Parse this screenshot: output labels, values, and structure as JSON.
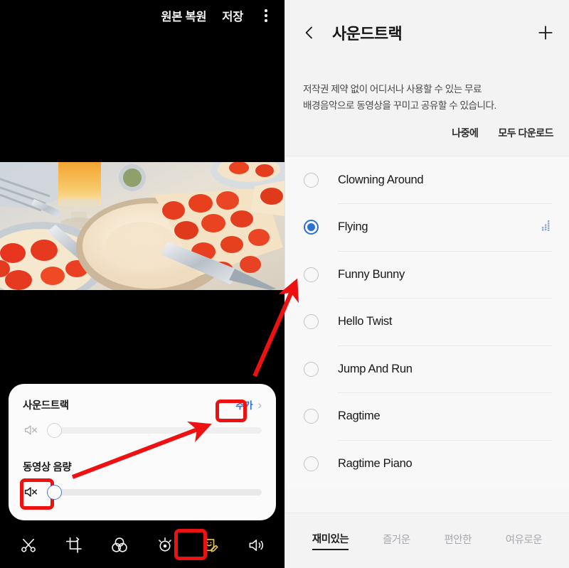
{
  "editor": {
    "topbar": {
      "restore_label": "원본 복원",
      "save_label": "저장",
      "menu_icon": "kebab-menu-icon"
    },
    "panel": {
      "soundtrack_label": "사운드트랙",
      "add_label": "추가",
      "chevron": "›",
      "video_volume_label": "동영상 음량",
      "soundtrack_volume_value": "0",
      "video_volume_value": "0",
      "mute_icon": "mute-icon"
    },
    "toolbar": {
      "items": [
        {
          "name": "trim-icon",
          "label": "자르기"
        },
        {
          "name": "crop-rotate-icon",
          "label": "회전"
        },
        {
          "name": "filter-icon",
          "label": "필터"
        },
        {
          "name": "brightness-icon",
          "label": "밝기"
        },
        {
          "name": "sticker-icon",
          "label": "스티커",
          "active": true
        },
        {
          "name": "volume-icon",
          "label": "음량"
        }
      ]
    }
  },
  "soundtrack": {
    "header": {
      "back_icon": "back-chevron-icon",
      "title": "사운드트랙",
      "add_icon": "plus-icon"
    },
    "description_line1": "저작권 제약 없이 어디서나 사용할 수 있는 무료",
    "description_line2": "배경음악으로 동영상을 꾸미고 공유할 수 있습니다.",
    "actions": {
      "later_label": "나중에",
      "download_all_label": "모두 다운로드"
    },
    "tracks": [
      {
        "name": "Clowning Around",
        "selected": false,
        "playing": false
      },
      {
        "name": "Flying",
        "selected": true,
        "playing": true
      },
      {
        "name": "Funny Bunny",
        "selected": false,
        "playing": false
      },
      {
        "name": "Hello Twist",
        "selected": false,
        "playing": false
      },
      {
        "name": "Jump And Run",
        "selected": false,
        "playing": false
      },
      {
        "name": "Ragtime",
        "selected": false,
        "playing": false
      },
      {
        "name": "Ragtime Piano",
        "selected": false,
        "playing": false
      }
    ],
    "tabs": [
      {
        "label": "재미있는",
        "active": true
      },
      {
        "label": "즐거운",
        "active": false
      },
      {
        "label": "편안한",
        "active": false
      },
      {
        "label": "여유로운",
        "active": false
      }
    ]
  },
  "annotations": {
    "accent_color": "#ee1111",
    "boxes": [
      "추가",
      "동영상 음량 음소거",
      "스티커 도구"
    ],
    "arrows": 2
  }
}
